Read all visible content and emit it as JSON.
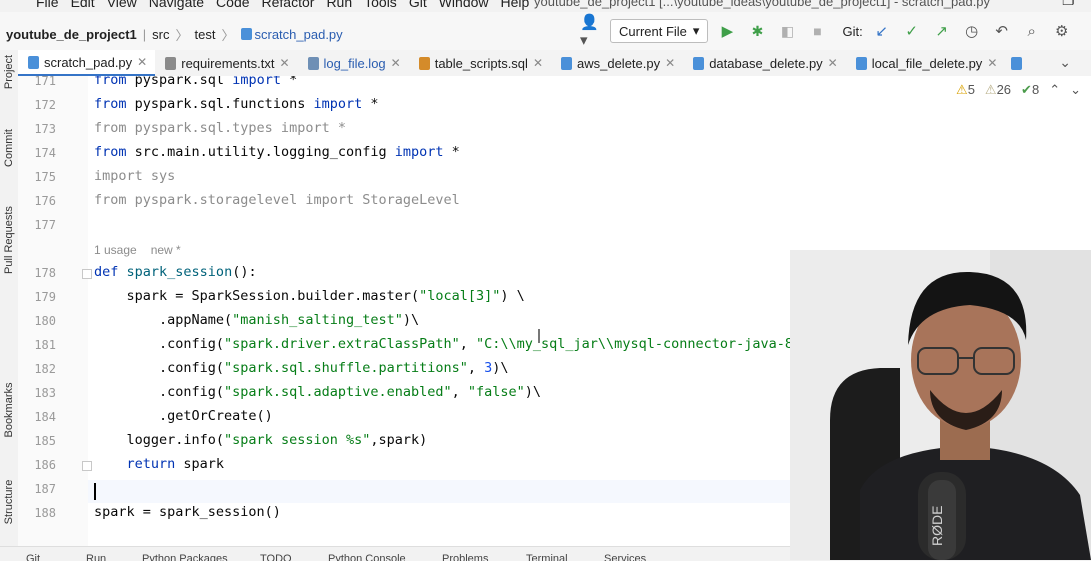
{
  "menubar": {
    "items": [
      "File",
      "Edit",
      "View",
      "Navigate",
      "Code",
      "Refactor",
      "Run",
      "Tools",
      "Git",
      "Window",
      "Help"
    ],
    "window_title": "youtube_de_project1 [...\\youtube_ideas\\youtube_de_project1] - scratch_pad.py"
  },
  "navbar": {
    "project": "youtube_de_project1",
    "crumbs": [
      "src",
      "test"
    ],
    "file": "scratch_pad.py",
    "run_config": "Current File",
    "git_label": "Git:"
  },
  "tabs": [
    {
      "label": "scratch_pad.py",
      "kind": "py",
      "active": true
    },
    {
      "label": "requirements.txt",
      "kind": "txt",
      "active": false
    },
    {
      "label": "log_file.log",
      "kind": "log",
      "active": false
    },
    {
      "label": "table_scripts.sql",
      "kind": "sql",
      "active": false
    },
    {
      "label": "aws_delete.py",
      "kind": "py",
      "active": false
    },
    {
      "label": "database_delete.py",
      "kind": "py",
      "active": false
    },
    {
      "label": "local_file_delete.py",
      "kind": "py",
      "active": false
    }
  ],
  "inspections": {
    "warnings": "5",
    "weak_warnings": "26",
    "typos": "8"
  },
  "left_tools": [
    "Project",
    "Commit",
    "Pull Requests",
    "Bookmarks",
    "Structure"
  ],
  "editor": {
    "lines": [
      {
        "n": "171",
        "text": "from pyspark.sql import *"
      },
      {
        "n": "172",
        "text": "from pyspark.sql.functions import *"
      },
      {
        "n": "173",
        "text": "from pyspark.sql.types import *"
      },
      {
        "n": "174",
        "text": "from src.main.utility.logging_config import *"
      },
      {
        "n": "175",
        "text": "import sys"
      },
      {
        "n": "176",
        "text": "from pyspark.storagelevel import StorageLevel"
      },
      {
        "n": "177",
        "text": ""
      },
      {
        "n": "178",
        "text": "def spark_session():"
      },
      {
        "n": "179",
        "text": "    spark = SparkSession.builder.master(\"local[3]\") \\"
      },
      {
        "n": "180",
        "text": "        .appName(\"manish_salting_test\")\\"
      },
      {
        "n": "181",
        "text": "        .config(\"spark.driver.extraClassPath\", \"C:\\\\my_sql_jar\\\\mysql-connector-java-8.0.26.jar\")"
      },
      {
        "n": "182",
        "text": "        .config(\"spark.sql.shuffle.partitions\", 3)\\"
      },
      {
        "n": "183",
        "text": "        .config(\"spark.sql.adaptive.enabled\", \"false\")\\"
      },
      {
        "n": "184",
        "text": "        .getOrCreate()"
      },
      {
        "n": "185",
        "text": "    logger.info(\"spark session %s\",spark)"
      },
      {
        "n": "186",
        "text": "    return spark"
      },
      {
        "n": "187",
        "text": ""
      },
      {
        "n": "188",
        "text": "spark = spark_session()"
      }
    ],
    "inlay_usage": "1 usage",
    "inlay_new": "new *"
  },
  "bottom_tools": [
    "Git",
    "Run",
    "Python Packages",
    "TODO",
    "Python Console",
    "Problems",
    "Terminal",
    "Services"
  ]
}
